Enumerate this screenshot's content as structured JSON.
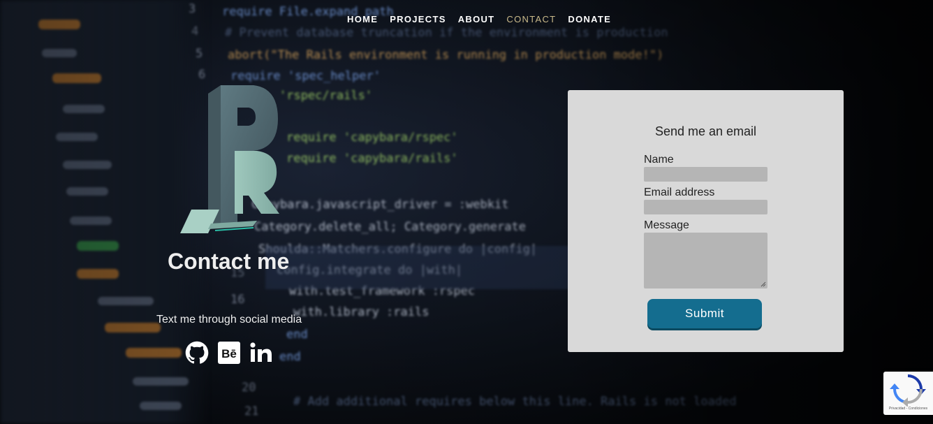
{
  "nav": {
    "items": [
      {
        "label": "HOME",
        "active": false
      },
      {
        "label": "PROJECTS",
        "active": false
      },
      {
        "label": "ABOUT",
        "active": false
      },
      {
        "label": "CONTACT",
        "active": true
      },
      {
        "label": "DONATE",
        "active": false
      }
    ],
    "active_color": "#c9b98a"
  },
  "hero": {
    "title": "Contact me",
    "social_text": "Text me through social media",
    "social_icons": [
      "github-icon",
      "behance-icon",
      "linkedin-icon"
    ]
  },
  "form": {
    "heading": "Send me an email",
    "name_label": "Name",
    "email_label": "Email address",
    "message_label": "Message",
    "name_value": "",
    "email_value": "",
    "message_value": "",
    "submit_label": "Submit",
    "accent": "#146d8f"
  },
  "recaptcha": {
    "footer": "Privacidad - Condiciones"
  }
}
